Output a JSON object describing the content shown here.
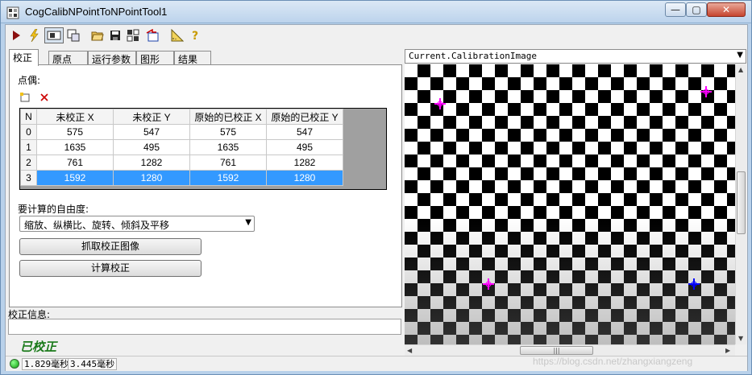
{
  "window": {
    "title": "CogCalibNPointToNPointTool1",
    "controls": {
      "minimize": "—",
      "maximize": "▢",
      "close": "✕"
    }
  },
  "toolbar": {
    "icons": [
      "run-icon",
      "electric-run-icon",
      "show-image-icon",
      "float-window-icon",
      "open-icon",
      "save-icon",
      "reset-icon",
      "import-icon",
      "ruler-icon",
      "help-icon"
    ]
  },
  "tabs": [
    "校正",
    "原点",
    "运行参数",
    "图形",
    "结果"
  ],
  "calibration": {
    "point_pairs_label": "点偶:",
    "table": {
      "headers": [
        "N",
        "未校正 X",
        "未校正 Y",
        "原始的已校正 X",
        "原始的已校正 Y"
      ],
      "rows": [
        [
          "0",
          "575",
          "547",
          "575",
          "547"
        ],
        [
          "1",
          "1635",
          "495",
          "1635",
          "495"
        ],
        [
          "2",
          "761",
          "1282",
          "761",
          "1282"
        ],
        [
          "3",
          "1592",
          "1280",
          "1592",
          "1280"
        ]
      ],
      "selected_row": 3
    },
    "dof_label": "要计算的自由度:",
    "dof_value": "缩放、纵横比、旋转、倾斜及平移",
    "grab_button": "抓取校正图像",
    "compute_button": "计算校正"
  },
  "info": {
    "label": "校正信息:",
    "status": "已校正"
  },
  "statusbar": {
    "time1": "1.829毫秒",
    "time2": "3.445毫秒"
  },
  "image_view": {
    "selector": "Current.CalibrationImage"
  },
  "watermark": "https://blog.csdn.net/zhangxiangzeng",
  "colors": {
    "selection": "#3399ff",
    "status_green": "#1a7a1a",
    "marker_magenta": "#ff00ff",
    "marker_blue": "#0000ff"
  }
}
